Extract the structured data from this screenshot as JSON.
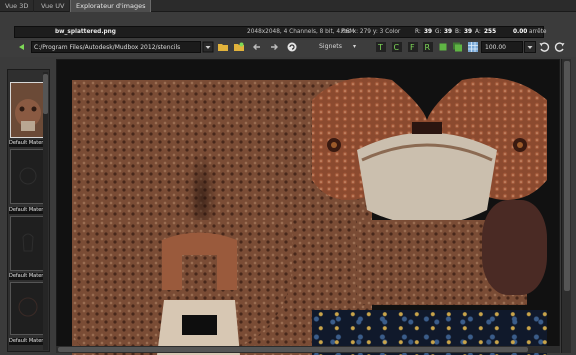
{
  "tabs": [
    {
      "label": "Vue 3D"
    },
    {
      "label": "Vue UV"
    },
    {
      "label": "Explorateur d'images"
    }
  ],
  "info": {
    "filename": "bw_splattered.png",
    "details": "2048x2048, 4 Channels, 8 bit,    4.06M",
    "pos_label": "Pos x: 279 y: 3 Color",
    "r_label": "R:",
    "r_value": "39",
    "g_label": "G:",
    "g_value": "39",
    "b_label": "B:",
    "b_value": "39",
    "a_label": "A:",
    "a_value": "255",
    "extra": "0.00",
    "extra_label": "arrête"
  },
  "toolbar": {
    "path": "C:/Program Files/Autodesk/Mudbox 2012/stencils",
    "signets_label": "Signets",
    "zoom_value": "100.00"
  },
  "thumbnails": [
    {
      "label": "Default Materia"
    },
    {
      "label": "Default Materia"
    },
    {
      "label": "Default Materia"
    },
    {
      "label": "Default Materia"
    }
  ],
  "colors": {
    "leather": "#7a4c35",
    "bone": "#cbbfae",
    "accent_green": "#5fb544",
    "toolbar_bg": "#3d3d3d"
  },
  "icons": [
    "back-green-arrow-icon",
    "dropdown-arrow-icon",
    "folder-open-icon",
    "folder-star-icon",
    "arrow-left-icon",
    "arrow-right-icon",
    "refresh-icon",
    "signets-dropdown-icon",
    "mode-t-icon",
    "mode-c-icon",
    "mode-f-icon",
    "mode-r-icon",
    "square-green-icon",
    "layers-icon",
    "grid-icon",
    "zoom-dropdown-icon",
    "undo-icon",
    "redo-icon"
  ]
}
